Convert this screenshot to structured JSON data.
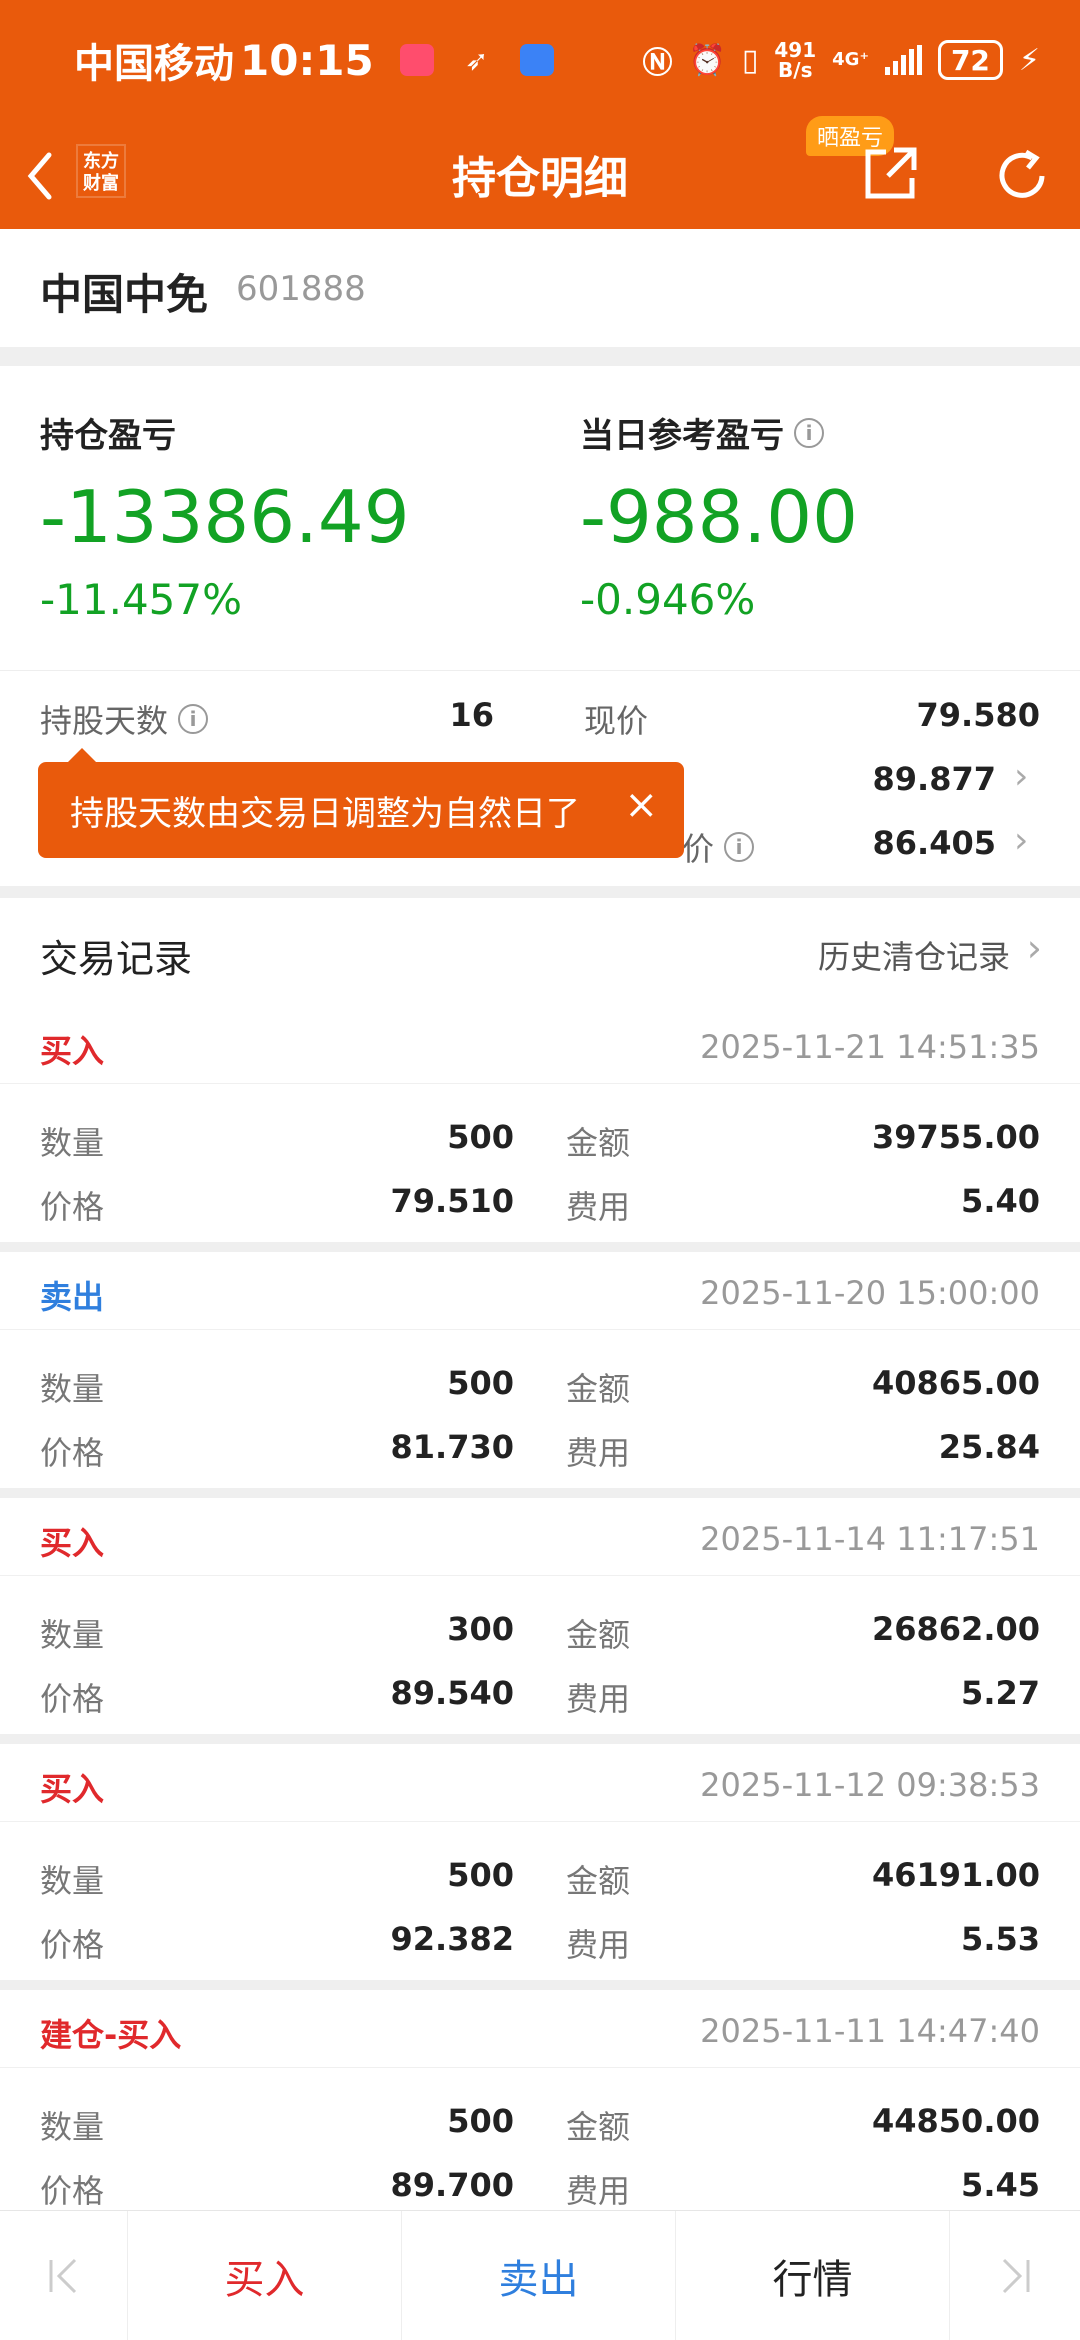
{
  "status": {
    "carrier": "中国移动",
    "time": "10:15",
    "netspeed_num": "491",
    "netspeed_unit": "B/s",
    "network": "4G⁺",
    "battery": "72"
  },
  "nav": {
    "title": "持仓明细",
    "logo_line1": "东方",
    "logo_line2": "财富",
    "share_badge": "晒盈亏"
  },
  "stock": {
    "name": "中国中免",
    "code": "601888"
  },
  "pl": {
    "position_label": "持仓盈亏",
    "position_value": "-13386.49",
    "position_pct": "-11.457%",
    "daily_label": "当日参考盈亏",
    "daily_value": "-988.00",
    "daily_pct": "-0.946%"
  },
  "stats": {
    "days_label": "持股天数",
    "days_value": "16",
    "price_label": "现价",
    "price_value": "79.580",
    "row2_value": "89.877",
    "row3_label_tail": "价",
    "row3_value": "86.405"
  },
  "tooltip": {
    "text": "持股天数由交易日调整为自然日了",
    "close": "×"
  },
  "trades": {
    "title": "交易记录",
    "history_label": "历史清仓记录"
  },
  "labels": {
    "qty": "数量",
    "amount": "金额",
    "price": "价格",
    "fee": "费用"
  },
  "records": [
    {
      "type": "买入",
      "time": "2025-11-21 14:51:35",
      "qty": "500",
      "amount": "39755.00",
      "price": "79.510",
      "fee": "5.40"
    },
    {
      "type": "卖出",
      "time": "2025-11-20 15:00:00",
      "qty": "500",
      "amount": "40865.00",
      "price": "81.730",
      "fee": "25.84"
    },
    {
      "type": "买入",
      "time": "2025-11-14 11:17:51",
      "qty": "300",
      "amount": "26862.00",
      "price": "89.540",
      "fee": "5.27"
    },
    {
      "type": "买入",
      "time": "2025-11-12 09:38:53",
      "qty": "500",
      "amount": "46191.00",
      "price": "92.382",
      "fee": "5.53"
    },
    {
      "type": "建仓-买入",
      "time": "2025-11-11 14:47:40",
      "qty": "500",
      "amount": "44850.00",
      "price": "89.700",
      "fee": "5.45"
    }
  ],
  "bottom": {
    "buy": "买入",
    "sell": "卖出",
    "market": "行情"
  },
  "colors": {
    "brand": "#e95a0c",
    "loss": "#12a224",
    "buy": "#e0292c",
    "sell": "#2f7fde"
  }
}
